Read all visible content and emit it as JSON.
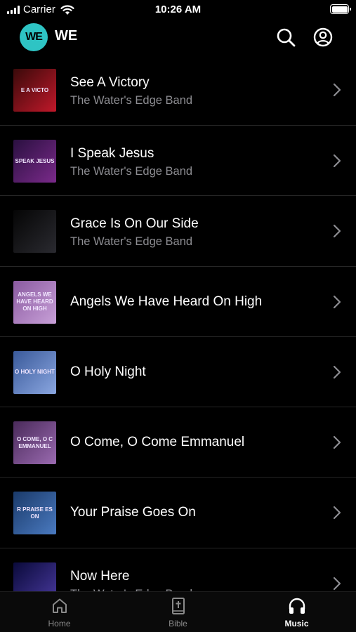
{
  "status_bar": {
    "carrier": "Carrier",
    "time": "10:26 AM"
  },
  "header": {
    "logo_text": "WE",
    "title": "WE",
    "logo_color": "#2ec4c4"
  },
  "songs": [
    {
      "title": "See A Victory",
      "artist": "The Water's Edge Band",
      "thumb_text": "E A VICTO",
      "thumb_colors": [
        "#3a0a0a",
        "#c0182a"
      ]
    },
    {
      "title": "I Speak Jesus",
      "artist": "The Water's Edge Band",
      "thumb_text": "SPEAK JESUS",
      "thumb_colors": [
        "#2a1040",
        "#7a2a8a"
      ]
    },
    {
      "title": "Grace Is On Our Side",
      "artist": "The Water's Edge Band",
      "thumb_text": "",
      "thumb_colors": [
        "#050505",
        "#2a2a30"
      ]
    },
    {
      "title": "Angels We Have Heard On High",
      "artist": "",
      "thumb_text": "ANGELS WE HAVE HEARD ON HIGH",
      "thumb_colors": [
        "#8a5aa0",
        "#c8a0d8"
      ]
    },
    {
      "title": "O Holy Night",
      "artist": "",
      "thumb_text": "O HOLY NIGHT",
      "thumb_colors": [
        "#3a5a9a",
        "#8aa6e0"
      ]
    },
    {
      "title": "O Come, O Come Emmanuel",
      "artist": "",
      "thumb_text": "O COME, O C EMMANUEL",
      "thumb_colors": [
        "#4a2a5a",
        "#9a6ab0"
      ]
    },
    {
      "title": "Your Praise Goes On",
      "artist": "",
      "thumb_text": "R PRAISE ES ON",
      "thumb_colors": [
        "#1a3a6a",
        "#4a7ac0"
      ]
    },
    {
      "title": "Now Here",
      "artist": "The Water's Edge Band",
      "thumb_text": "",
      "thumb_colors": [
        "#0a0a3a",
        "#4a3aa0"
      ]
    }
  ],
  "tabs": [
    {
      "label": "Home",
      "icon": "home-icon",
      "active": false
    },
    {
      "label": "Bible",
      "icon": "bible-icon",
      "active": false
    },
    {
      "label": "Music",
      "icon": "headphones-icon",
      "active": true
    }
  ]
}
